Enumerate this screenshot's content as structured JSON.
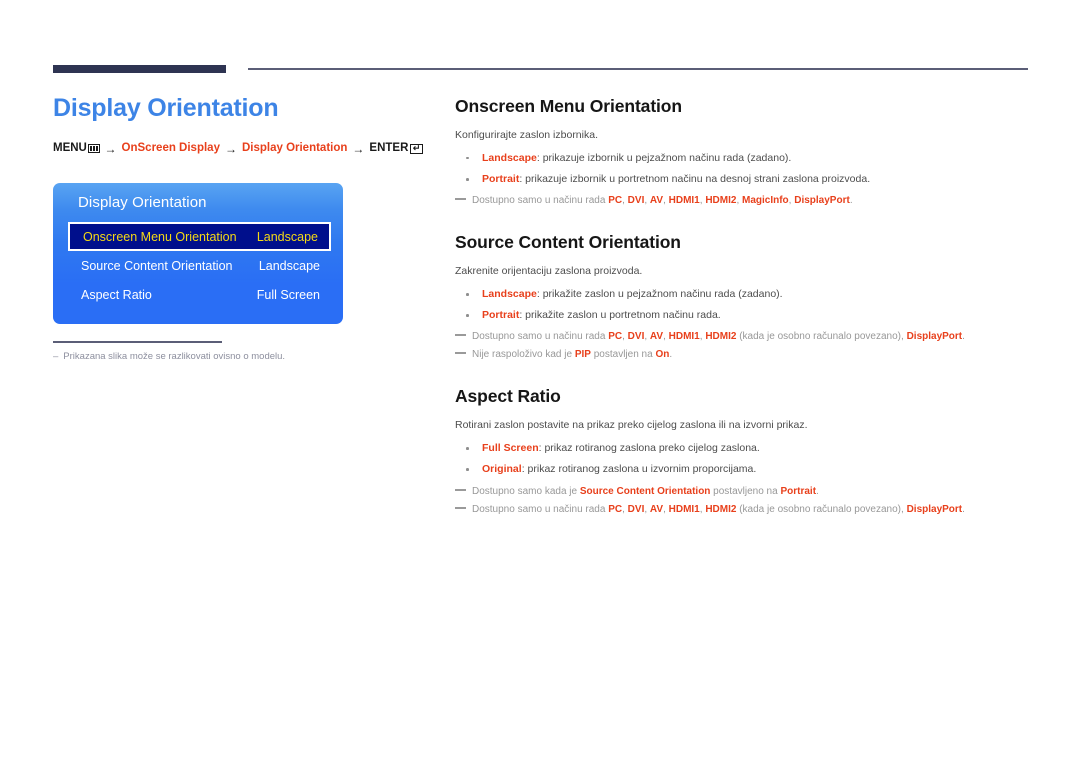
{
  "page": {
    "title": "Display Orientation",
    "breadcrumb": {
      "menu_label": "MENU",
      "menu_icon": "menu-bars-icon",
      "arrow": "→",
      "step1": "OnScreen Display",
      "step2": "Display Orientation",
      "enter_label": "ENTER",
      "enter_icon": "enter-return-icon"
    },
    "footnote": {
      "dash": "–",
      "text": "Prikazana slika može se razlikovati ovisno o modelu."
    },
    "colors": {
      "title_blue": "#3d84e6",
      "keyword_red": "#e8401c",
      "rule_navy": "#2e3452",
      "osd_blue": "#2a6ef5",
      "osd_selected_bg": "#000f8c",
      "osd_selected_text": "#f4d915"
    }
  },
  "osd": {
    "title": "Display Orientation",
    "rows": [
      {
        "label": "Onscreen Menu Orientation",
        "value": "Landscape",
        "selected": true
      },
      {
        "label": "Source Content Orientation",
        "value": "Landscape",
        "selected": false
      },
      {
        "label": "Aspect Ratio",
        "value": "Full Screen",
        "selected": false
      }
    ]
  },
  "sections": [
    {
      "title": "Onscreen Menu Orientation",
      "intro": "Konfigurirajte zaslon izbornika.",
      "bullets": [
        {
          "keyword": "Landscape",
          "text": ": prikazuje izbornik u pejzažnom načinu rada (zadano)."
        },
        {
          "keyword": "Portrait",
          "text": ": prikazuje izbornik u portretnom načinu na desnoj strani zaslona proizvoda."
        }
      ],
      "notes": [
        {
          "parts": [
            {
              "t": "Dostupno samo u načinu rada ",
              "kw": false
            },
            {
              "t": "PC",
              "kw": true
            },
            {
              "t": ", ",
              "kw": false
            },
            {
              "t": "DVI",
              "kw": true
            },
            {
              "t": ", ",
              "kw": false
            },
            {
              "t": "AV",
              "kw": true
            },
            {
              "t": ", ",
              "kw": false
            },
            {
              "t": "HDMI1",
              "kw": true
            },
            {
              "t": ", ",
              "kw": false
            },
            {
              "t": "HDMI2",
              "kw": true
            },
            {
              "t": ", ",
              "kw": false
            },
            {
              "t": "MagicInfo",
              "kw": true
            },
            {
              "t": ", ",
              "kw": false
            },
            {
              "t": "DisplayPort",
              "kw": true
            },
            {
              "t": ".",
              "kw": false
            }
          ]
        }
      ]
    },
    {
      "title": "Source Content Orientation",
      "intro": "Zakrenite orijentaciju zaslona proizvoda.",
      "bullets": [
        {
          "keyword": "Landscape",
          "text": ": prikažite zaslon u pejzažnom načinu rada (zadano)."
        },
        {
          "keyword": "Portrait",
          "text": ": prikažite zaslon u portretnom načinu rada."
        }
      ],
      "notes": [
        {
          "parts": [
            {
              "t": "Dostupno samo u načinu rada ",
              "kw": false
            },
            {
              "t": "PC",
              "kw": true
            },
            {
              "t": ", ",
              "kw": false
            },
            {
              "t": "DVI",
              "kw": true
            },
            {
              "t": ", ",
              "kw": false
            },
            {
              "t": "AV",
              "kw": true
            },
            {
              "t": ", ",
              "kw": false
            },
            {
              "t": "HDMI1",
              "kw": true
            },
            {
              "t": ", ",
              "kw": false
            },
            {
              "t": "HDMI2",
              "kw": true
            },
            {
              "t": " (kada je osobno računalo povezano), ",
              "kw": false
            },
            {
              "t": "DisplayPort",
              "kw": true
            },
            {
              "t": ".",
              "kw": false
            }
          ]
        },
        {
          "parts": [
            {
              "t": "Nije raspoloživo kad je ",
              "kw": false
            },
            {
              "t": "PIP",
              "kw": true
            },
            {
              "t": " postavljen na ",
              "kw": false
            },
            {
              "t": "On",
              "kw": true
            },
            {
              "t": ".",
              "kw": false
            }
          ]
        }
      ]
    },
    {
      "title": "Aspect Ratio",
      "intro": "Rotirani zaslon postavite na prikaz preko cijelog zaslona ili na izvorni prikaz.",
      "bullets": [
        {
          "keyword": "Full Screen",
          "text": ": prikaz rotiranog zaslona preko cijelog zaslona."
        },
        {
          "keyword": "Original",
          "text": ": prikaz rotiranog zaslona u izvornim proporcijama."
        }
      ],
      "notes": [
        {
          "parts": [
            {
              "t": "Dostupno samo kada je ",
              "kw": false
            },
            {
              "t": "Source Content Orientation",
              "kw": true
            },
            {
              "t": " postavljeno na ",
              "kw": false
            },
            {
              "t": "Portrait",
              "kw": true
            },
            {
              "t": ".",
              "kw": false
            }
          ]
        },
        {
          "parts": [
            {
              "t": "Dostupno samo u načinu rada ",
              "kw": false
            },
            {
              "t": "PC",
              "kw": true
            },
            {
              "t": ", ",
              "kw": false
            },
            {
              "t": "DVI",
              "kw": true
            },
            {
              "t": ", ",
              "kw": false
            },
            {
              "t": "AV",
              "kw": true
            },
            {
              "t": ", ",
              "kw": false
            },
            {
              "t": "HDMI1",
              "kw": true
            },
            {
              "t": ", ",
              "kw": false
            },
            {
              "t": "HDMI2",
              "kw": true
            },
            {
              "t": " (kada je osobno računalo povezano), ",
              "kw": false
            },
            {
              "t": "DisplayPort",
              "kw": true
            },
            {
              "t": ".",
              "kw": false
            }
          ]
        }
      ]
    }
  ]
}
